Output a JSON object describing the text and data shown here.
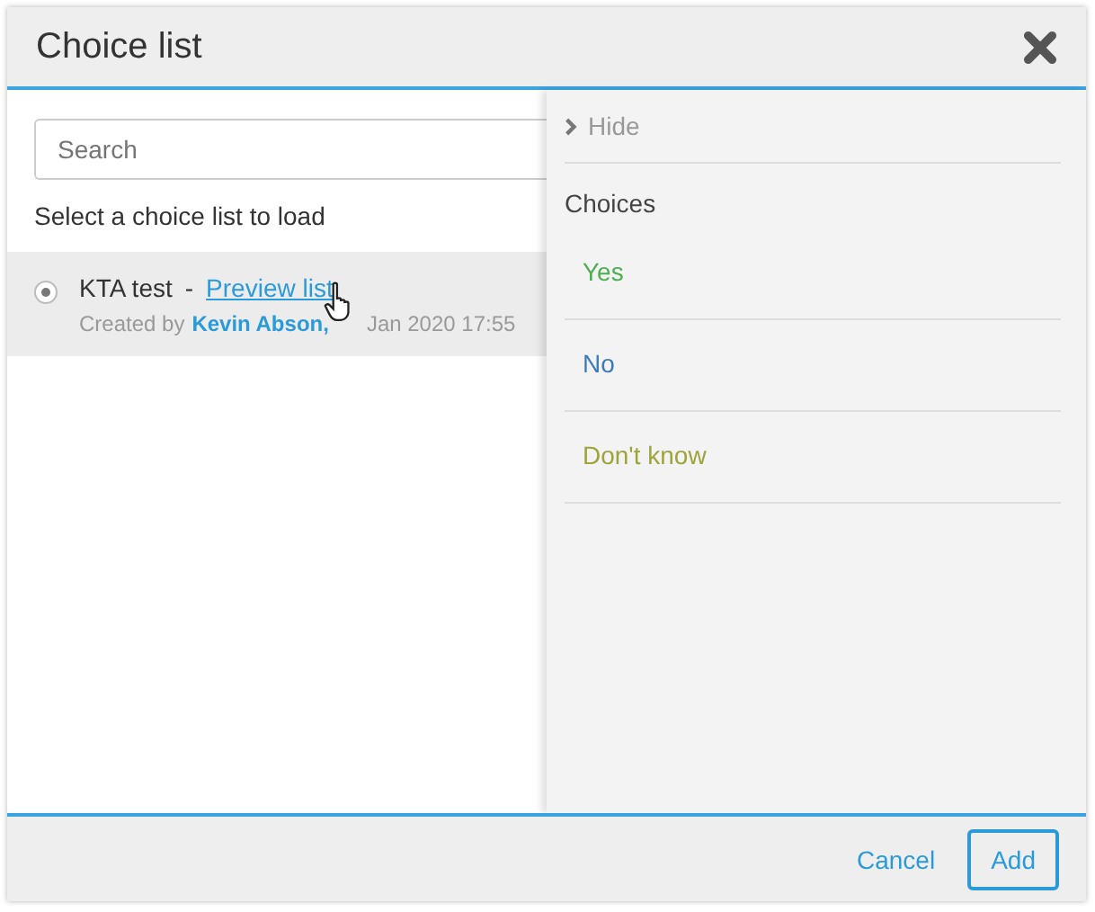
{
  "window": {
    "title": "Choice list"
  },
  "search": {
    "placeholder": "Search"
  },
  "instruction": "Select a choice list to load",
  "lists": [
    {
      "name": "KTA test",
      "separator": "-",
      "link": "Preview list",
      "created_label": "Created by",
      "author": "Kevin Abson,",
      "date": "Jan 2020 17:55",
      "selected": true
    }
  ],
  "panel": {
    "hide_label": "Hide",
    "heading": "Choices",
    "choices": [
      {
        "label": "Yes",
        "color": "#4caf50"
      },
      {
        "label": "No",
        "color": "#3d7bb5"
      },
      {
        "label": "Don't know",
        "color": "#9ea33a"
      }
    ]
  },
  "buttons": {
    "cancel": "Cancel",
    "add": "Add"
  }
}
